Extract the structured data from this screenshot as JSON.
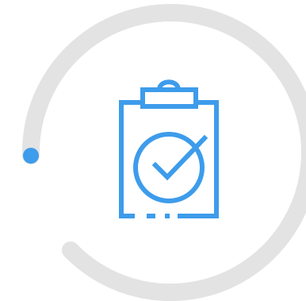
{
  "widget": {
    "progress_icon": "clipboard-check-icon",
    "progress_fraction": 0.8,
    "colors": {
      "track": "#e3e3e3",
      "accent": "#3d9ceb",
      "background": "#ffffff"
    }
  }
}
